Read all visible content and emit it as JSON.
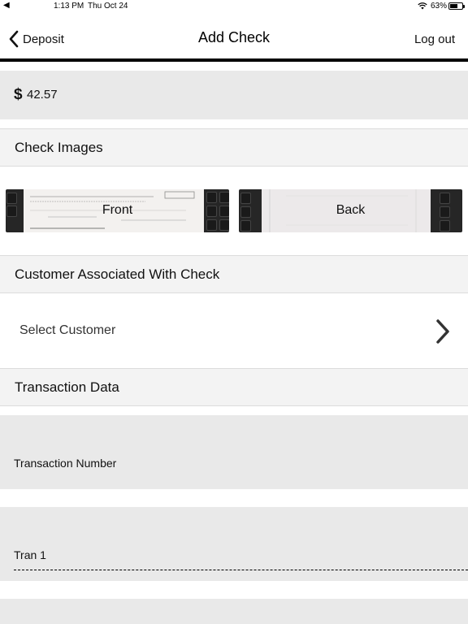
{
  "status_bar": {
    "back_app": "◀",
    "time": "1:13 PM",
    "date": "Thu Oct 24",
    "battery": "63%",
    "battery_level": 0.63
  },
  "nav": {
    "back_label": "Deposit",
    "title": "Add Check",
    "logout_label": "Log out"
  },
  "amount": {
    "currency_symbol": "$",
    "value": "42.57"
  },
  "sections": {
    "check_images": "Check Images",
    "customer": "Customer Associated With Check",
    "transaction_data": "Transaction Data"
  },
  "check_images": {
    "front_label": "Front",
    "back_label": "Back"
  },
  "customer": {
    "select_label": "Select Customer"
  },
  "transaction": {
    "number_label": "Transaction Number",
    "number_value": "Tran 1"
  }
}
